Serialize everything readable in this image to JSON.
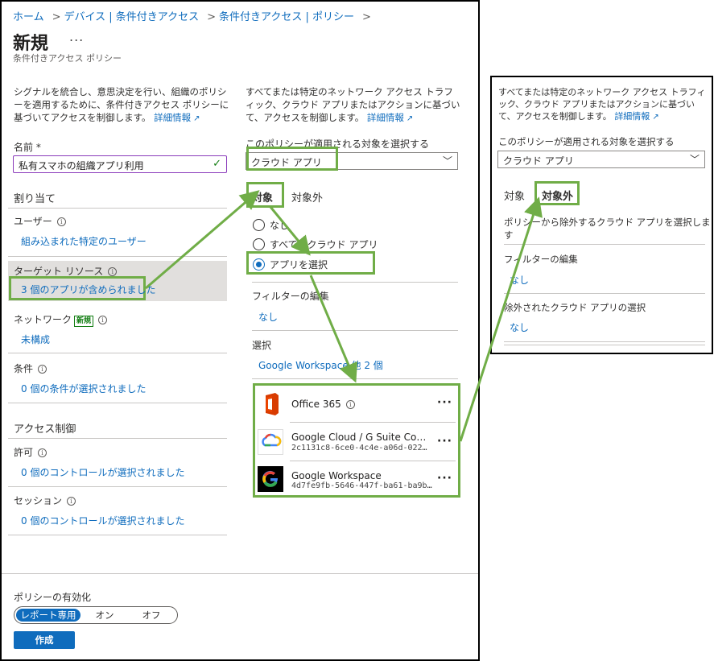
{
  "breadcrumb": {
    "items": [
      "ホーム",
      "デバイス | 条件付きアクセス",
      "条件付きアクセス | ポリシー"
    ]
  },
  "header": {
    "title": "新規",
    "more": "...",
    "subtitle": "条件付きアクセス ポリシー"
  },
  "left": {
    "intro": "シグナルを統合し、意思決定を行い、組織のポリシーを適用するために、条件付きアクセス ポリシーに基づいてアクセスを制御します。",
    "intro_link": "詳細情報",
    "name_label": "名前 *",
    "name_value": "私有スマホの組織アプリ利用",
    "assignments_heading": "割り当て",
    "users_label": "ユーザー",
    "users_value": "組み込まれた特定のユーザー",
    "target_label": "ターゲット リソース",
    "target_value": "3 個のアプリが含められました",
    "network_label": "ネットワーク",
    "network_badge": "新規",
    "network_value": "未構成",
    "conditions_label": "条件",
    "conditions_value": "0 個の条件が選択されました",
    "access_heading": "アクセス制御",
    "grant_label": "許可",
    "grant_value": "0 個のコントロールが選択されました",
    "session_label": "セッション",
    "session_value": "0 個のコントロールが選択されました"
  },
  "footer": {
    "enable_label": "ポリシーの有効化",
    "toggle": [
      "レポート専用",
      "オン",
      "オフ"
    ],
    "create_button": "作成"
  },
  "middle": {
    "intro": "すべてまたは特定のネットワーク アクセス トラフィック、クラウド アプリまたはアクションに基づいて、アクセスを制御します。",
    "intro_link": "詳細情報",
    "select_label": "このポリシーが適用される対象を選択する",
    "dropdown_value": "クラウド アプリ",
    "tab_include": "対象",
    "tab_exclude": "対象外",
    "radio_none": "なし",
    "radio_all": "すべてのクラウド アプリ",
    "radio_select": "アプリを選択",
    "filter_label": "フィルターの編集",
    "filter_value": "なし",
    "select_heading": "選択",
    "select_value": "Google Workspace 他 2 個",
    "apps": [
      {
        "name": "Office 365",
        "id": "",
        "icon": "office-365-logo"
      },
      {
        "name": "Google Cloud / G Suite Co…",
        "id": "2c1131c8-6ce0-4c4e-a06d-022…",
        "icon": "google-cloud-logo"
      },
      {
        "name": "Google Workspace",
        "id": "4d7fe9fb-5646-447f-ba61-ba9b…",
        "icon": "google-g-logo"
      }
    ]
  },
  "side": {
    "intro": "すべてまたは特定のネットワーク アクセス トラフィック、クラウド アプリまたはアクションに基づいて、アクセスを制御します。",
    "intro_link": "詳細情報",
    "select_label": "このポリシーが適用される対象を選択する",
    "dropdown_value": "クラウド アプリ",
    "tab_include": "対象",
    "tab_exclude": "対象外",
    "exclude_desc": "ポリシーから除外するクラウド アプリを選択します",
    "filter_label": "フィルターの編集",
    "filter_value": "なし",
    "excluded_label": "除外されたクラウド アプリの選択",
    "excluded_value": "なし"
  },
  "colors": {
    "accent": "#0f6cbd",
    "highlight": "#70ad47",
    "selected_bg": "#e1dfdd"
  }
}
